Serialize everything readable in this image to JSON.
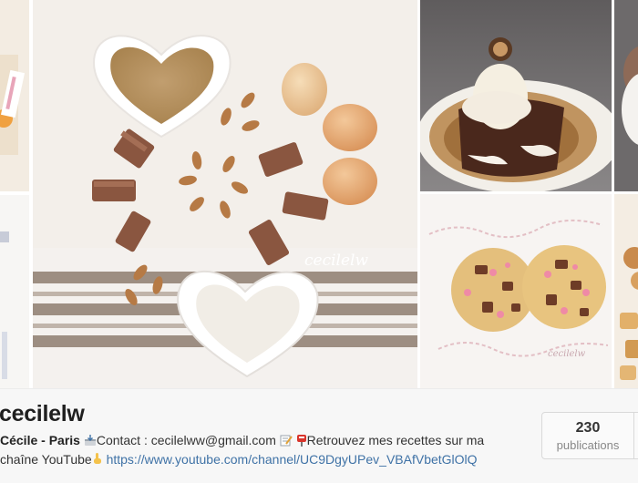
{
  "profile": {
    "username": "cecilelw",
    "bio_name": "Cécile - Paris",
    "bio_contact": "Contact : cecilelww@gmail.com",
    "bio_recettes": "Retrouvez mes recettes sur ma",
    "bio_chaine": "chaîne YouTube",
    "bio_link": "https://www.youtube.com/channel/UC9DgyUPev_VBAfVbetGlOlQ",
    "icons": [
      "inbox-tray-icon",
      "memo-icon",
      "postbox-icon",
      "pointing-down-icon"
    ]
  },
  "stats": {
    "count": "230",
    "label": "publications"
  },
  "photos": {
    "watermark": "cecilelw",
    "watermark_small": "cecilelw",
    "tiles": [
      "baking-ingredients-photo",
      "lava-cake-photo",
      "cookies-photo"
    ]
  },
  "colors": {
    "link": "#3f72a6",
    "profile_bg": "#f7f7f7"
  }
}
